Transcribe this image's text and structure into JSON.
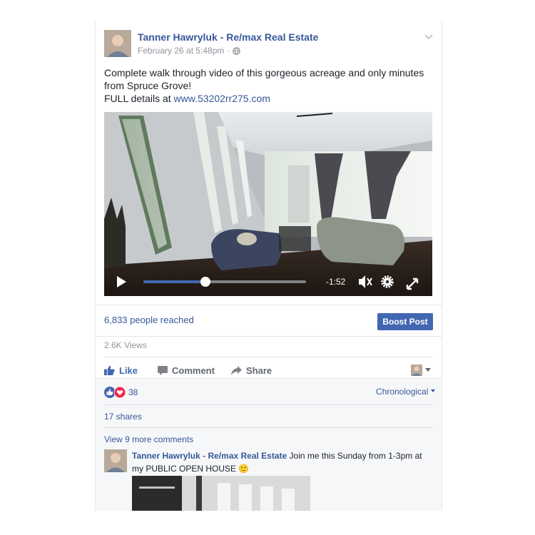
{
  "post": {
    "author": "Tanner Hawryluk - Re/max Real Estate",
    "date": "February 26 at 5:48pm",
    "separator": "·",
    "text_line1": "Complete walk through video of this gorgeous acreage and only minutes",
    "text_line2": "from Spruce Grove!",
    "text_line3_prefix": "FULL details at ",
    "link": "www.53202rr275.com"
  },
  "video": {
    "time_remaining": "-1:52",
    "progress": 0.38,
    "icons": [
      "play-icon",
      "mute-icon",
      "settings-gear-icon",
      "fullscreen-icon"
    ]
  },
  "stats": {
    "reached": "6,833 people reached",
    "boost_label": "Boost Post",
    "views": "2.6K Views"
  },
  "actions": {
    "like": "Like",
    "comment": "Comment",
    "share": "Share"
  },
  "reactions": {
    "count": "38",
    "sort_label": "Chronological",
    "shares": "17 shares",
    "view_more": "View 9 more comments"
  },
  "comment": {
    "author": "Tanner Hawryluk - Re/max Real Estate",
    "text": " Join me this Sunday from 1-3pm at my PUBLIC OPEN HOUSE ",
    "emoji": "🙂"
  },
  "colors": {
    "link_blue": "#365899",
    "boost_blue": "#4267b2",
    "muted_gray": "#90949c",
    "like_blue": "#4267b2",
    "love_red": "#f0284a"
  }
}
